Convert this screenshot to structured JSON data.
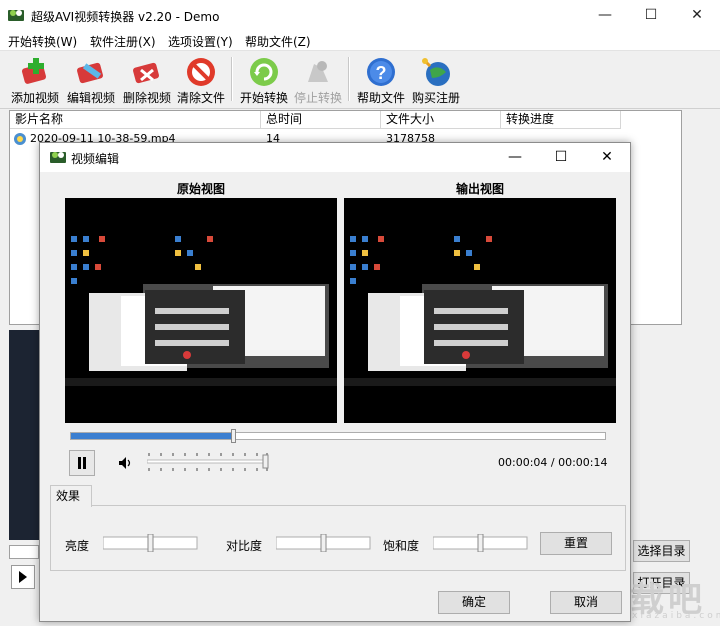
{
  "window": {
    "title": "超级AVI视频转换器 v2.20 - Demo",
    "controls": {
      "minimize": "—",
      "maximize": "☐",
      "close": "✕"
    }
  },
  "menu": [
    "开始转换(W)",
    "软件注册(X)",
    "选项设置(Y)",
    "帮助文件(Z)"
  ],
  "toolbar": {
    "buttons": [
      {
        "label": "添加视频",
        "icon": "add-video-icon",
        "enabled": true
      },
      {
        "label": "编辑视频",
        "icon": "edit-video-icon",
        "enabled": true
      },
      {
        "label": "删除视频",
        "icon": "delete-video-icon",
        "enabled": true
      },
      {
        "label": "清除文件",
        "icon": "clear-files-icon",
        "enabled": true
      },
      {
        "label": "开始转换",
        "icon": "start-convert-icon",
        "enabled": true
      },
      {
        "label": "停止转换",
        "icon": "stop-convert-icon",
        "enabled": false
      },
      {
        "label": "帮助文件",
        "icon": "help-icon",
        "enabled": true
      },
      {
        "label": "购买注册",
        "icon": "buy-register-icon",
        "enabled": true
      }
    ]
  },
  "file_list": {
    "columns": [
      "影片名称",
      "总时间",
      "文件大小",
      "转换进度"
    ],
    "rows": [
      {
        "name": "2020-09-11 10-38-59.mp4",
        "duration": "14",
        "size": "3178758",
        "progress": ""
      }
    ]
  },
  "side_buttons": {
    "choose_dir": "选择目录",
    "open_dir": "打开目录"
  },
  "dialog": {
    "title": "视频编辑",
    "source_label": "原始视图",
    "output_label": "输出视图",
    "seek_fraction": 0.3,
    "time": "00:00:04 / 00:00:14",
    "effects_tab": "效果",
    "brightness_label": "亮度",
    "contrast_label": "对比度",
    "saturation_label": "饱和度",
    "reset_label": "重置",
    "ok_label": "确定",
    "cancel_label": "取消"
  },
  "watermark": {
    "main": "下载吧",
    "sub": "www.xiazaiba.com"
  },
  "colors": {
    "accent": "#3c7fd0",
    "video_bg": "#000000"
  }
}
